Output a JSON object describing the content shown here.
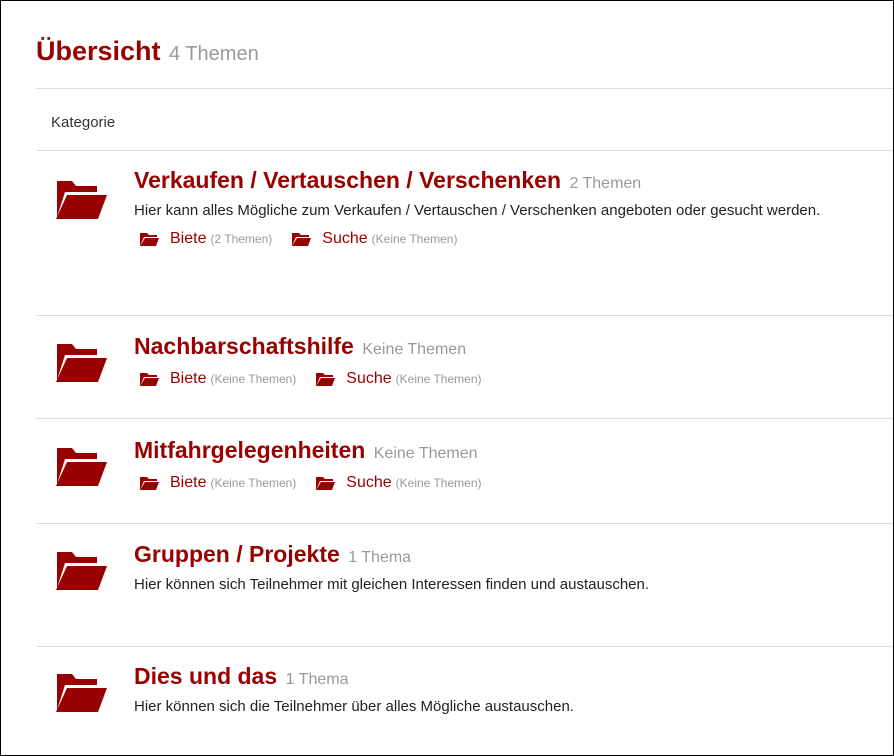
{
  "header": {
    "title": "Übersicht",
    "count": "4 Themen"
  },
  "table": {
    "column_label": "Kategorie"
  },
  "colors": {
    "accent": "#990000",
    "muted": "#999999"
  },
  "categories": [
    {
      "icon": "folder-open-icon",
      "title": "Verkaufen / Vertauschen / Verschenken",
      "count": "2 Themen",
      "description": "Hier kann alles Mögliche zum Verkaufen / Vertauschen / Verschenken angeboten oder gesucht werden.",
      "subforums": [
        {
          "name": "Biete",
          "count": "(2 Themen)"
        },
        {
          "name": "Suche",
          "count": "(Keine Themen)"
        }
      ]
    },
    {
      "icon": "folder-open-icon",
      "title": "Nachbarschaftshilfe",
      "count": "Keine Themen",
      "subforums": [
        {
          "name": "Biete",
          "count": "(Keine Themen)"
        },
        {
          "name": "Suche",
          "count": "(Keine Themen)"
        }
      ]
    },
    {
      "icon": "folder-open-icon",
      "title": "Mitfahrgelegenheiten",
      "count": "Keine Themen",
      "subforums": [
        {
          "name": "Biete",
          "count": "(Keine Themen)"
        },
        {
          "name": "Suche",
          "count": "(Keine Themen)"
        }
      ]
    },
    {
      "icon": "folder-open-icon",
      "title": "Gruppen / Projekte",
      "count": "1 Thema",
      "description": "Hier können sich Teilnehmer mit gleichen Interessen finden und austauschen."
    },
    {
      "icon": "folder-open-icon",
      "title": "Dies und das",
      "count": "1 Thema",
      "description": "Hier können sich die Teilnehmer über alles Mögliche austauschen."
    }
  ]
}
